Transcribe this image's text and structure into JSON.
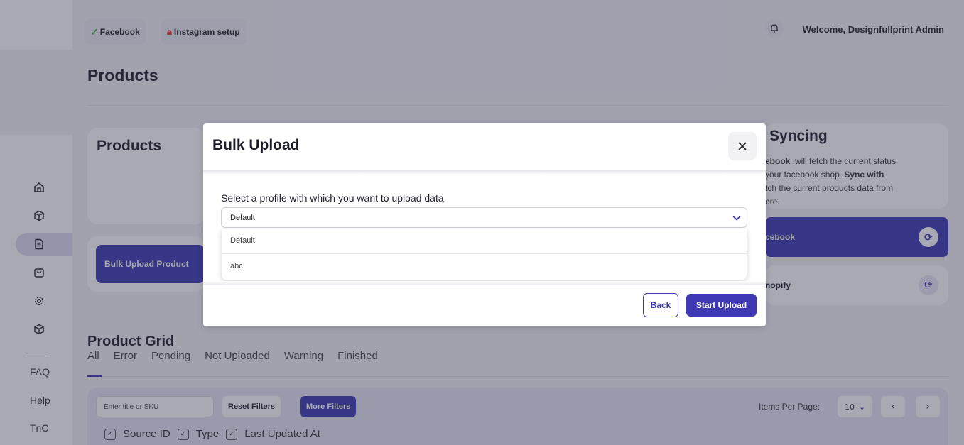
{
  "topbar": {
    "facebook_chip": "Facebook",
    "instagram_chip": "Instagram setup",
    "welcome": "Welcome, Designfullprint Admin"
  },
  "page": {
    "title": "Products"
  },
  "sidebar": {
    "icons": [
      "home-icon",
      "box-icon",
      "document-icon",
      "bag-icon",
      "gear-icon",
      "box-icon"
    ],
    "links": [
      "FAQ",
      "Help",
      "TnC"
    ]
  },
  "products_card": {
    "title": "Products",
    "bulk_button": "Bulk Upload Product"
  },
  "syncing_card": {
    "title": "Syncing",
    "description_line1_bold": "ebook",
    "description_line1": " ,will fetch the current status",
    "description_line2": " your facebook shop .",
    "description_line2_bold": "Sync with",
    "description_line3": "tch the current products data from",
    "description_line4": "ore.",
    "facebook_button": "cebook",
    "shopify_button": "nopify"
  },
  "product_grid": {
    "title": "Product Grid",
    "tabs": [
      "All",
      "Error",
      "Pending",
      "Not Uploaded",
      "Warning",
      "Finished"
    ],
    "search_placeholder": "Enter title or SKU",
    "reset_filters": "Reset Filters",
    "more_filters": "More Filters",
    "items_per_page_label": "Items Per Page:",
    "items_per_page_value": "10",
    "columns": [
      "Source ID",
      "Type",
      "Last Updated At"
    ]
  },
  "modal": {
    "title": "Bulk Upload",
    "label": "Select a profile with which you want to upload data",
    "selected": "Default",
    "options": [
      "Default",
      "abc"
    ],
    "back": "Back",
    "start_upload": "Start Upload"
  },
  "colors": {
    "accent": "#3f3ab3",
    "overlay": "#30324b"
  }
}
